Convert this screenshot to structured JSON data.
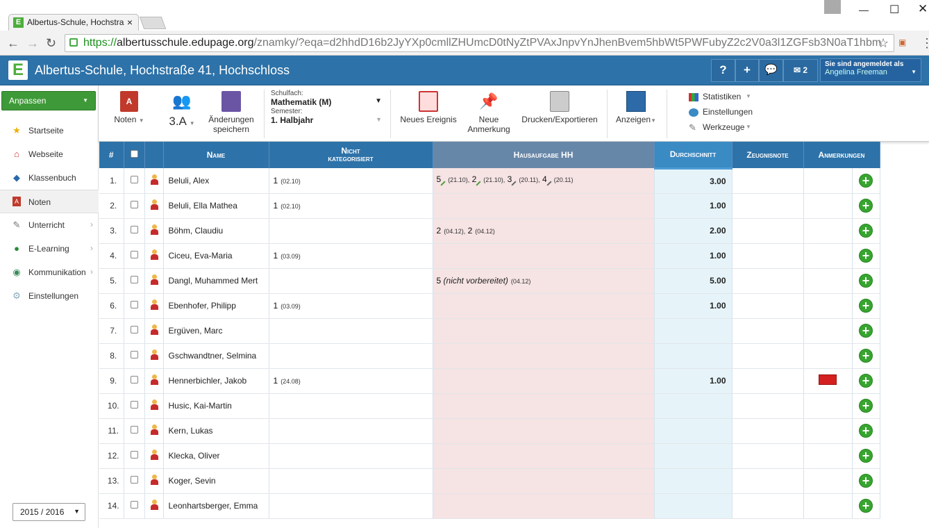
{
  "browser": {
    "tab_title": "Albertus-Schule, Hochstra",
    "url_scheme": "https://",
    "url_host": "albertusschule.edupage.org",
    "url_path": "/znamky/?eqa=d2hhdD16b2JyYXp0cmllZHUmcD0tNyZtPVAxJnpvYnJhenBvem5hbWt5PWFubyZ2c2V0a3l1ZGFsb3N0aT1hbm"
  },
  "header": {
    "school": "Albertus-Schule, Hochstraße 41, Hochschloss",
    "help": "?",
    "add": "+",
    "msg_count": "2",
    "login_label": "Sie sind angemeldet als",
    "user": "Angelina Freeman"
  },
  "sidebar": {
    "customize": "Anpassen",
    "items": [
      {
        "label": "Startseite"
      },
      {
        "label": "Webseite"
      },
      {
        "label": "Klassenbuch"
      },
      {
        "label": "Noten"
      },
      {
        "label": "Unterricht"
      },
      {
        "label": "E-Learning"
      },
      {
        "label": "Kommunikation"
      },
      {
        "label": "Einstellungen"
      }
    ],
    "year": "2015 / 2016"
  },
  "toolbar": {
    "noten": "Noten",
    "klasse": "3.A",
    "save_line1": "Änderungen",
    "save_line2": "speichern",
    "subject_label": "Schulfach:",
    "subject": "Mathematik (M)",
    "semester_label": "Semester:",
    "semester": "1. Halbjahr",
    "new_event": "Neues Ereignis",
    "new_note_1": "Neue",
    "new_note_2": "Anmerkung",
    "print": "Drucken/Exportieren",
    "view": "Anzeigen",
    "stats": "Statistiken",
    "settings": "Einstellungen",
    "tools": "Werkzeuge"
  },
  "table": {
    "headers": {
      "num": "#",
      "name": "Name",
      "nk1": "Nicht",
      "nk2": "kategorisiert",
      "hw": "Hausaufgabe HH",
      "avg": "Durchschnitt",
      "zn": "Zeugnisnote",
      "an": "Anmerkungen"
    },
    "rows": [
      {
        "n": "1.",
        "name": "Beluli, Alex",
        "nk": [
          {
            "g": "1",
            "d": "(02.10)"
          }
        ],
        "hw": [
          {
            "g": "5",
            "d": "(21.10),"
          },
          {
            "g": "2",
            "d": "(21.10),"
          },
          {
            "g": "3",
            "d": "(20.11),"
          },
          {
            "g": "4",
            "d": "(20.11)"
          }
        ],
        "avg": "3.00",
        "mail": false
      },
      {
        "n": "2.",
        "name": "Beluli, Ella Mathea",
        "nk": [
          {
            "g": "1",
            "d": "(02.10)"
          }
        ],
        "hw": [],
        "avg": "1.00",
        "mail": false
      },
      {
        "n": "3.",
        "name": "Böhm, Claudiu",
        "nk": [],
        "hw": [
          {
            "g": "2",
            "d": "(04.12),"
          },
          {
            "g": "2",
            "d": "(04.12)"
          }
        ],
        "avg": "2.00",
        "mail": false
      },
      {
        "n": "4.",
        "name": "Ciceu, Eva-Maria",
        "nk": [
          {
            "g": "1",
            "d": "(03.09)"
          }
        ],
        "hw": [],
        "avg": "1.00",
        "mail": false
      },
      {
        "n": "5.",
        "name": "Dangl, Muhammed Mert",
        "nk": [],
        "hw": [
          {
            "g": "5",
            "note": "(nicht vorbereitet)",
            "d": "(04.12)"
          }
        ],
        "avg": "5.00",
        "mail": false
      },
      {
        "n": "6.",
        "name": "Ebenhofer, Philipp",
        "nk": [
          {
            "g": "1",
            "d": "(03.09)"
          }
        ],
        "hw": [],
        "avg": "1.00",
        "mail": false
      },
      {
        "n": "7.",
        "name": "Ergüven, Marc",
        "nk": [],
        "hw": [],
        "avg": "",
        "mail": false
      },
      {
        "n": "8.",
        "name": "Gschwandtner, Selmina",
        "nk": [],
        "hw": [],
        "avg": "",
        "mail": false
      },
      {
        "n": "9.",
        "name": "Hennerbichler, Jakob",
        "nk": [
          {
            "g": "1",
            "d": "(24.08)"
          }
        ],
        "hw": [],
        "avg": "1.00",
        "mail": true
      },
      {
        "n": "10.",
        "name": "Husic, Kai-Martin",
        "nk": [],
        "hw": [],
        "avg": "",
        "mail": false
      },
      {
        "n": "11.",
        "name": "Kern, Lukas",
        "nk": [],
        "hw": [],
        "avg": "",
        "mail": false
      },
      {
        "n": "12.",
        "name": "Klecka, Oliver",
        "nk": [],
        "hw": [],
        "avg": "",
        "mail": false
      },
      {
        "n": "13.",
        "name": "Koger, Sevin",
        "nk": [],
        "hw": [],
        "avg": "",
        "mail": false
      },
      {
        "n": "14.",
        "name": "Leonhartsberger, Emma",
        "nk": [],
        "hw": [],
        "avg": "",
        "mail": false
      }
    ]
  }
}
